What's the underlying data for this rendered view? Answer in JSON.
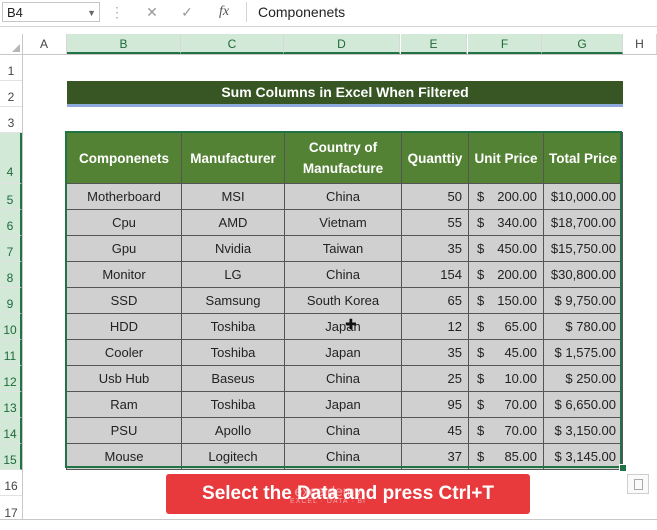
{
  "formula_bar": {
    "name_box": "B4",
    "cancel_icon": "✕",
    "enter_icon": "✓",
    "fx_label": "fx",
    "formula": "Componenets"
  },
  "columns": [
    "A",
    "B",
    "C",
    "D",
    "E",
    "F",
    "G",
    "H"
  ],
  "rows": [
    "1",
    "2",
    "3",
    "4",
    "5",
    "6",
    "7",
    "8",
    "9",
    "10",
    "11",
    "12",
    "13",
    "14",
    "15",
    "16",
    "17"
  ],
  "title": "Sum  Columns in Excel When Filtered",
  "table": {
    "headers": [
      "Componenets",
      "Manufacturer",
      "Country of Manufacture",
      "Quanttiy",
      "Unit Price",
      "Total Price"
    ],
    "rows": [
      [
        "Motherboard",
        "MSI",
        "China",
        "50",
        "$",
        "200.00",
        "$10,000.00"
      ],
      [
        "Cpu",
        "AMD",
        "Vietnam",
        "55",
        "$",
        "340.00",
        "$18,700.00"
      ],
      [
        "Gpu",
        "Nvidia",
        "Taiwan",
        "35",
        "$",
        "450.00",
        "$15,750.00"
      ],
      [
        "Monitor",
        "LG",
        "China",
        "154",
        "$",
        "200.00",
        "$30,800.00"
      ],
      [
        "SSD",
        "Samsung",
        "South Korea",
        "65",
        "$",
        "150.00",
        "$ 9,750.00"
      ],
      [
        "HDD",
        "Toshiba",
        "Japan",
        "12",
        "$",
        "65.00",
        "$ 780.00"
      ],
      [
        "Cooler",
        "Toshiba",
        "Japan",
        "35",
        "$",
        "45.00",
        "$ 1,575.00"
      ],
      [
        "Usb Hub",
        "Baseus",
        "China",
        "25",
        "$",
        "10.00",
        "$ 250.00"
      ],
      [
        "Ram",
        "Toshiba",
        "Japan",
        "95",
        "$",
        "70.00",
        "$ 6,650.00"
      ],
      [
        "PSU",
        "Apollo",
        "China",
        "45",
        "$",
        "70.00",
        "$ 3,150.00"
      ],
      [
        "Mouse",
        "Logitech",
        "China",
        "37",
        "$",
        "85.00",
        "$ 3,145.00"
      ]
    ]
  },
  "banner": {
    "text": "Select the Data and press Ctrl+T",
    "watermark_name": "exceldemy",
    "watermark_sub": "EXCEL · DATA · BI"
  },
  "colors": {
    "title_bg": "#375623",
    "header_bg": "#548235",
    "cell_bg": "#d0d0d0",
    "banner_bg": "#e8393d",
    "selection": "#217346"
  }
}
